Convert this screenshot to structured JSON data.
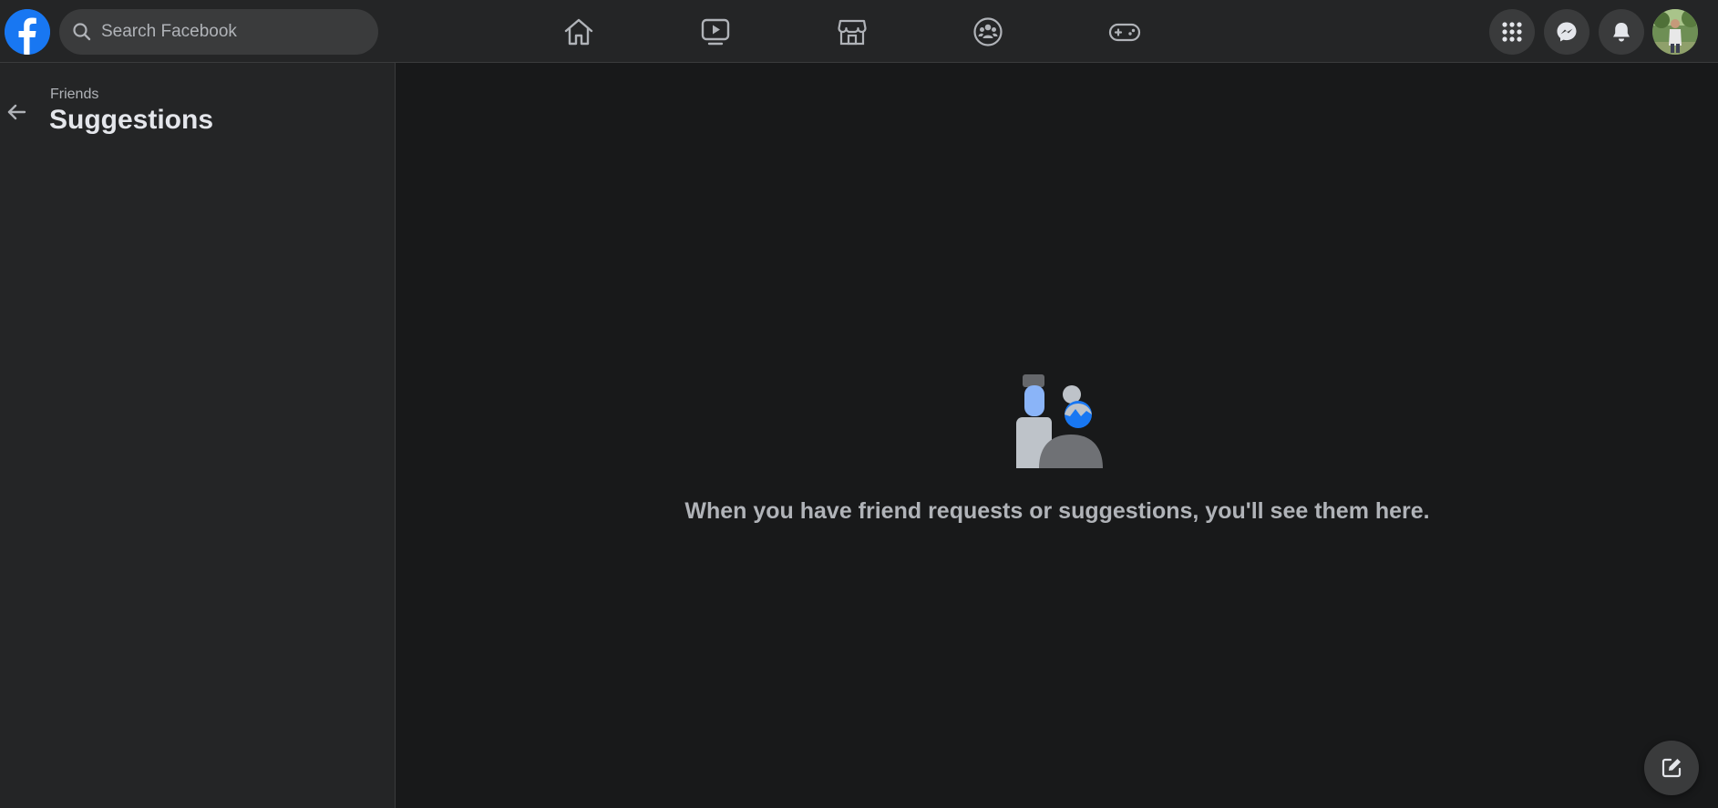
{
  "header": {
    "logo_icon": "facebook-logo-icon",
    "search": {
      "placeholder": "Search Facebook",
      "icon": "search-icon"
    },
    "nav": [
      {
        "name": "home",
        "icon": "home-icon"
      },
      {
        "name": "watch",
        "icon": "video-icon"
      },
      {
        "name": "marketplace",
        "icon": "marketplace-icon"
      },
      {
        "name": "groups",
        "icon": "groups-icon"
      },
      {
        "name": "gaming",
        "icon": "gaming-icon"
      }
    ],
    "actions": [
      {
        "name": "menu",
        "icon": "grid-menu-icon"
      },
      {
        "name": "messenger",
        "icon": "messenger-icon"
      },
      {
        "name": "notifications",
        "icon": "bell-icon"
      }
    ],
    "avatar_icon": "profile-avatar"
  },
  "sidebar": {
    "breadcrumb": "Friends",
    "title": "Suggestions",
    "back_icon": "arrow-left-icon"
  },
  "main": {
    "empty_message": "When you have friend requests or suggestions, you'll see them here.",
    "illustration_icon": "friends-illustration-icon"
  },
  "floating": {
    "compose_icon": "new-message-icon"
  },
  "colors": {
    "brand": "#1877f2",
    "topbar_bg": "#242526",
    "page_bg": "#18191a",
    "button_bg": "#3a3b3c",
    "text_primary": "#e4e6eb",
    "text_secondary": "#b0b3b8"
  }
}
